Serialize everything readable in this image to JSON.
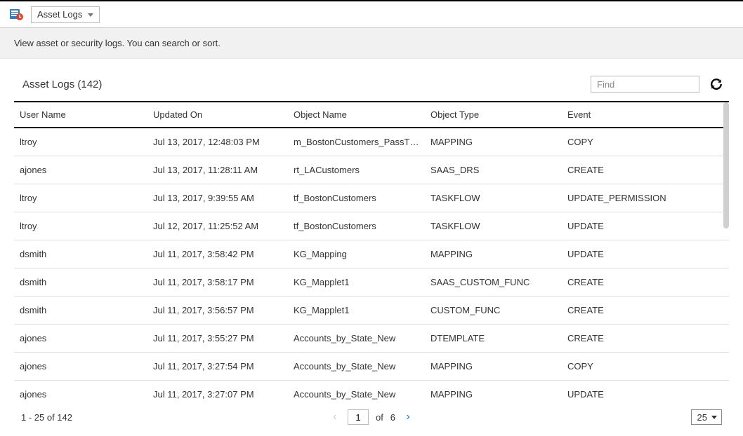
{
  "toolbar": {
    "log_type_selected": "Asset Logs"
  },
  "sub_header": {
    "text": "View asset or security logs. You can search or sort."
  },
  "panel": {
    "title": "Asset Logs (142)",
    "find_placeholder": "Find"
  },
  "table": {
    "columns": {
      "user": "User Name",
      "updated": "Updated On",
      "object": "Object Name",
      "type": "Object Type",
      "event": "Event"
    },
    "rows": [
      {
        "user": "ltroy",
        "updated": "Jul 13, 2017, 12:48:03 PM",
        "object": "m_BostonCustomers_PassThru",
        "type": "MAPPING",
        "event": "COPY"
      },
      {
        "user": "ajones",
        "updated": "Jul 13, 2017, 11:28:11 AM",
        "object": "rt_LACustomers",
        "type": "SAAS_DRS",
        "event": "CREATE"
      },
      {
        "user": "ltroy",
        "updated": "Jul 13, 2017, 9:39:55 AM",
        "object": "tf_BostonCustomers",
        "type": "TASKFLOW",
        "event": "UPDATE_PERMISSION"
      },
      {
        "user": "ltroy",
        "updated": "Jul 12, 2017, 11:25:52 AM",
        "object": "tf_BostonCustomers",
        "type": "TASKFLOW",
        "event": "UPDATE"
      },
      {
        "user": "dsmith",
        "updated": "Jul 11, 2017, 3:58:42 PM",
        "object": "KG_Mapping",
        "type": "MAPPING",
        "event": "UPDATE"
      },
      {
        "user": "dsmith",
        "updated": "Jul 11, 2017, 3:58:17 PM",
        "object": "KG_Mapplet1",
        "type": "SAAS_CUSTOM_FUNC",
        "event": "CREATE"
      },
      {
        "user": "dsmith",
        "updated": "Jul 11, 2017, 3:56:57 PM",
        "object": "KG_Mapplet1",
        "type": "CUSTOM_FUNC",
        "event": "CREATE"
      },
      {
        "user": "ajones",
        "updated": "Jul 11, 2017, 3:55:27 PM",
        "object": "Accounts_by_State_New",
        "type": "DTEMPLATE",
        "event": "CREATE"
      },
      {
        "user": "ajones",
        "updated": "Jul 11, 2017, 3:27:54 PM",
        "object": "Accounts_by_State_New",
        "type": "MAPPING",
        "event": "COPY"
      },
      {
        "user": "ajones",
        "updated": "Jul 11, 2017, 3:27:07 PM",
        "object": "Accounts_by_State_New",
        "type": "MAPPING",
        "event": "UPDATE"
      }
    ]
  },
  "pager": {
    "range_text": "1 - 25  of  142",
    "current_page": "1",
    "of_text": "of",
    "total_pages": "6",
    "page_size": "25"
  }
}
